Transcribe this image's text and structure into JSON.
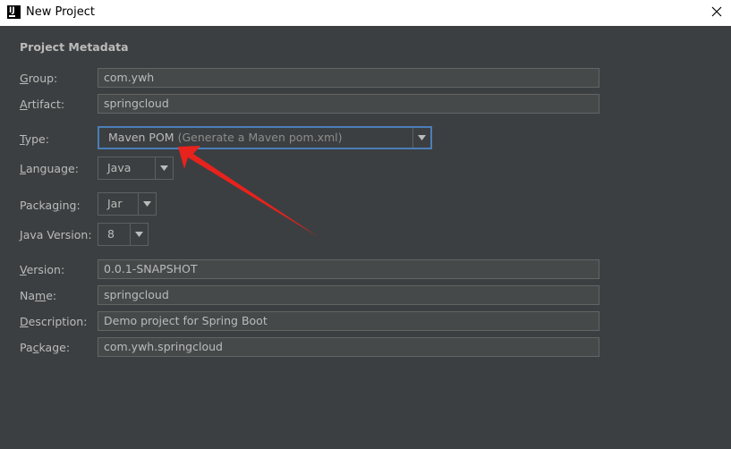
{
  "window": {
    "title": "New Project",
    "app_icon_text": "IJ"
  },
  "section": {
    "title": "Project Metadata"
  },
  "fields": {
    "group": {
      "label_key": "G",
      "label_rest": "roup:",
      "value": "com.ywh"
    },
    "artifact": {
      "label_key": "A",
      "label_rest": "rtifact:",
      "value": "springcloud"
    },
    "type": {
      "label_key": "T",
      "label_rest": "ype:",
      "value": "Maven POM",
      "hint": "(Generate a Maven pom.xml)"
    },
    "language": {
      "label_key": "L",
      "label_rest": "anguage:",
      "value": "Java"
    },
    "packaging": {
      "label_pre": "Packa",
      "label_key": "g",
      "label_rest": "ing:",
      "value": "Jar"
    },
    "java_version": {
      "label_key": "J",
      "label_rest": "ava Version:",
      "value": "8"
    },
    "version": {
      "label_key": "V",
      "label_rest": "ersion:",
      "value": "0.0.1-SNAPSHOT"
    },
    "name": {
      "label_pre": "Na",
      "label_key": "m",
      "label_rest": "e:",
      "value": "springcloud"
    },
    "description": {
      "label_key": "D",
      "label_rest": "escription:",
      "value": "Demo project for Spring Boot"
    },
    "package": {
      "label_pre": "Pa",
      "label_key": "c",
      "label_rest": "kage:",
      "value": "com.ywh.springcloud"
    }
  },
  "icons": {
    "app": "intellij-icon",
    "close": "close-icon",
    "dropdown": "chevron-down-icon",
    "annotation": "red-arrow-annotation"
  },
  "colors": {
    "background": "#3c3f41",
    "field_bg": "#45494a",
    "focus_border": "#4b7eb8",
    "annotation": "#e8221c"
  }
}
